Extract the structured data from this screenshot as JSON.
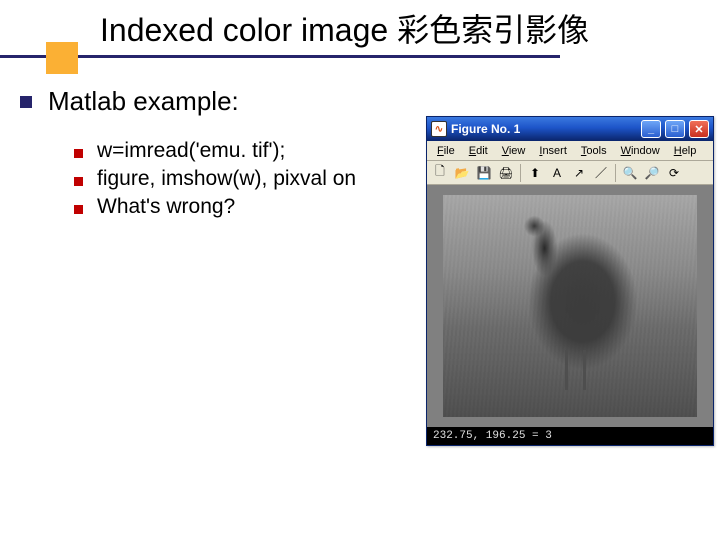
{
  "title": "Indexed color image 彩色索引影像",
  "heading": "Matlab example:",
  "items": [
    "w=imread('emu. tif');",
    "figure, imshow(w), pixval on",
    "What's wrong?"
  ],
  "figwin": {
    "title": "Figure No. 1",
    "menus": {
      "file": "File",
      "edit": "Edit",
      "view": "View",
      "insert": "Insert",
      "tools": "Tools",
      "window": "Window",
      "help": "Help"
    },
    "toolbar": {
      "new": "🗋",
      "open": "📂",
      "save": "💾",
      "print": "🖨",
      "pointer": "⬆",
      "text": "A",
      "arrow": "↗",
      "line": "／",
      "zoomin": "🔍",
      "zoomout": "🔎",
      "rotate": "⟳"
    },
    "status": "232.75, 196.25 =      3",
    "winbtns": {
      "min": "_",
      "max": "□",
      "close": "✕"
    },
    "app_icon": "∿"
  }
}
